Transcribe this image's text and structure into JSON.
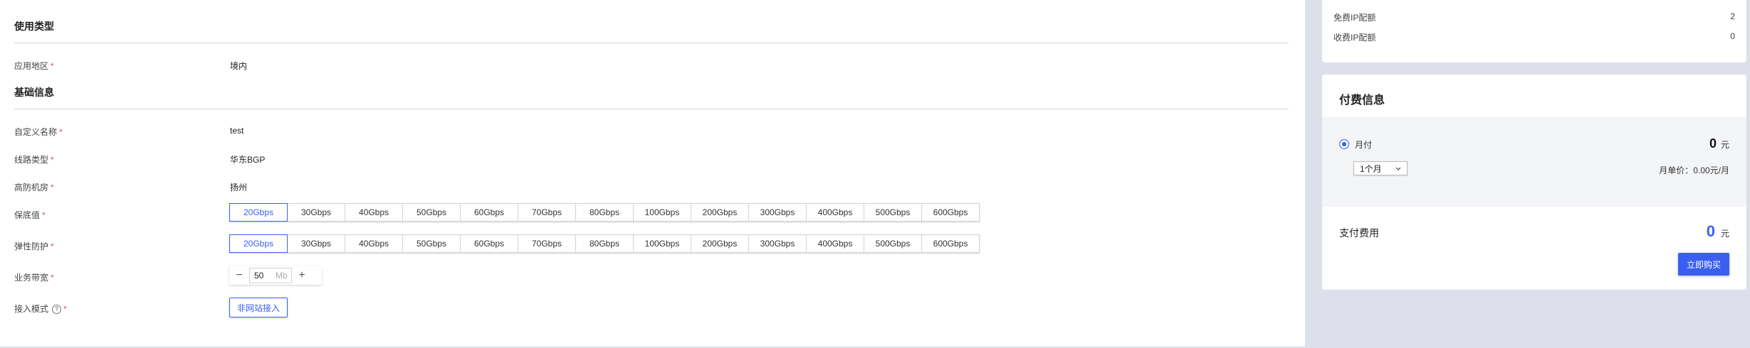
{
  "usage": {
    "title": "使用类型",
    "region_label": "应用地区",
    "region_value": "境内"
  },
  "basic": {
    "title": "基础信息",
    "name_label": "自定义名称",
    "name_value": "test",
    "line_label": "线路类型",
    "line_value": "华东BGP",
    "room_label": "高防机房",
    "room_value": "扬州",
    "guarantee_label": "保底值",
    "elastic_label": "弹性防护",
    "bandwidth_label": "业务带宽",
    "bandwidth_value": "50",
    "bandwidth_unit": "Mb",
    "mode_label": "接入模式",
    "mode_value": "非网站接入"
  },
  "guarantee_options": [
    "20Gbps",
    "30Gbps",
    "40Gbps",
    "50Gbps",
    "60Gbps",
    "70Gbps",
    "80Gbps",
    "100Gbps",
    "200Gbps",
    "300Gbps",
    "400Gbps",
    "500Gbps",
    "600Gbps"
  ],
  "elastic_options": [
    "20Gbps",
    "30Gbps",
    "40Gbps",
    "50Gbps",
    "60Gbps",
    "70Gbps",
    "80Gbps",
    "100Gbps",
    "200Gbps",
    "300Gbps",
    "400Gbps",
    "500Gbps",
    "600Gbps"
  ],
  "guarantee_selected": "20Gbps",
  "elastic_selected": "20Gbps",
  "quota": {
    "free_label": "免费IP配额",
    "free_value": "2",
    "paid_label": "收费IP配额",
    "paid_value": "0"
  },
  "payment": {
    "title": "付费信息",
    "monthly_label": "月付",
    "monthly_price": "0",
    "currency": "元",
    "duration_selected": "1个月",
    "unit_price": "月单价：0.00元/月",
    "fee_label": "支付费用",
    "total": "0",
    "buy_label": "立即购买"
  },
  "accent_color": "#3a5ff0",
  "required_color": "#e34d59"
}
